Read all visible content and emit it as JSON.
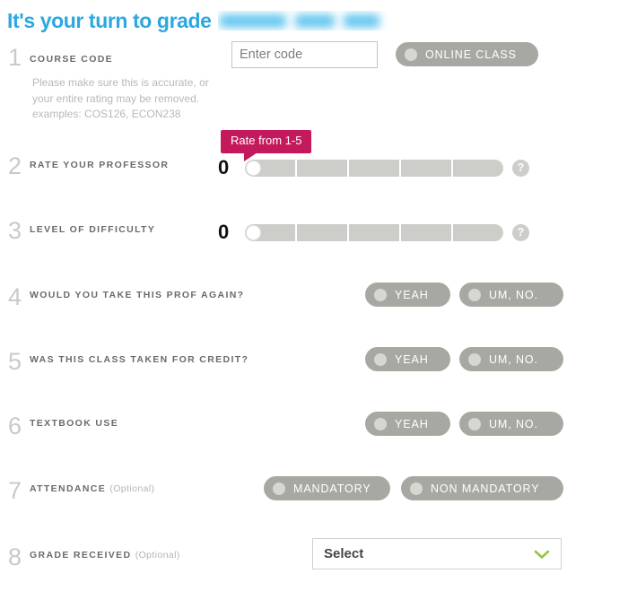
{
  "header": {
    "title": "It's your turn to grade",
    "professor_name_redacted": ""
  },
  "colors": {
    "accent_blue": "#2ca8e0",
    "tooltip_magenta": "#c4195c",
    "pill_gray": "#a8a8a3",
    "chevron_green": "#9ac43f",
    "label_gray": "#6b6b66",
    "step_number_gray": "#c9c9c5"
  },
  "steps": [
    {
      "number": "1",
      "label": "COURSE CODE",
      "optional": "",
      "helper_text": "Please make sure this is accurate, or your entire rating may be removed. examples: COS126, ECON238",
      "input": {
        "value": "",
        "placeholder": "Enter code",
        "autofill_icon": "autofill-dropdown-icon"
      },
      "toggle": {
        "label": "ONLINE CLASS",
        "selected": false
      }
    },
    {
      "number": "2",
      "label": "RATE YOUR PROFESSOR",
      "optional": "",
      "slider": {
        "value": "0",
        "min": 1,
        "max": 5,
        "segments": 5,
        "handle_position_pct": 0,
        "help_icon": "question-mark-icon",
        "help_icon_label": "?"
      },
      "tooltip": "Rate from 1-5"
    },
    {
      "number": "3",
      "label": "LEVEL OF DIFFICULTY",
      "optional": "",
      "slider": {
        "value": "0",
        "min": 1,
        "max": 5,
        "segments": 5,
        "handle_position_pct": 0,
        "help_icon": "question-mark-icon",
        "help_icon_label": "?"
      }
    },
    {
      "number": "4",
      "label": "WOULD YOU TAKE THIS PROF AGAIN?",
      "optional": "",
      "options": [
        {
          "label": "YEAH",
          "selected": false
        },
        {
          "label": "UM, NO.",
          "selected": false
        }
      ]
    },
    {
      "number": "5",
      "label": "WAS THIS CLASS TAKEN FOR CREDIT?",
      "optional": "",
      "options": [
        {
          "label": "YEAH",
          "selected": false
        },
        {
          "label": "UM, NO.",
          "selected": false
        }
      ]
    },
    {
      "number": "6",
      "label": "TEXTBOOK USE",
      "optional": "",
      "options": [
        {
          "label": "YEAH",
          "selected": false
        },
        {
          "label": "UM, NO.",
          "selected": false
        }
      ]
    },
    {
      "number": "7",
      "label": "ATTENDANCE",
      "optional": "(Optional)",
      "options": [
        {
          "label": "MANDATORY",
          "selected": false
        },
        {
          "label": "NON MANDATORY",
          "selected": false
        }
      ]
    },
    {
      "number": "8",
      "label": "GRADE RECEIVED",
      "optional": "(Optional)",
      "select": {
        "value": "Select",
        "chevron_icon": "chevron-down-icon"
      }
    }
  ]
}
